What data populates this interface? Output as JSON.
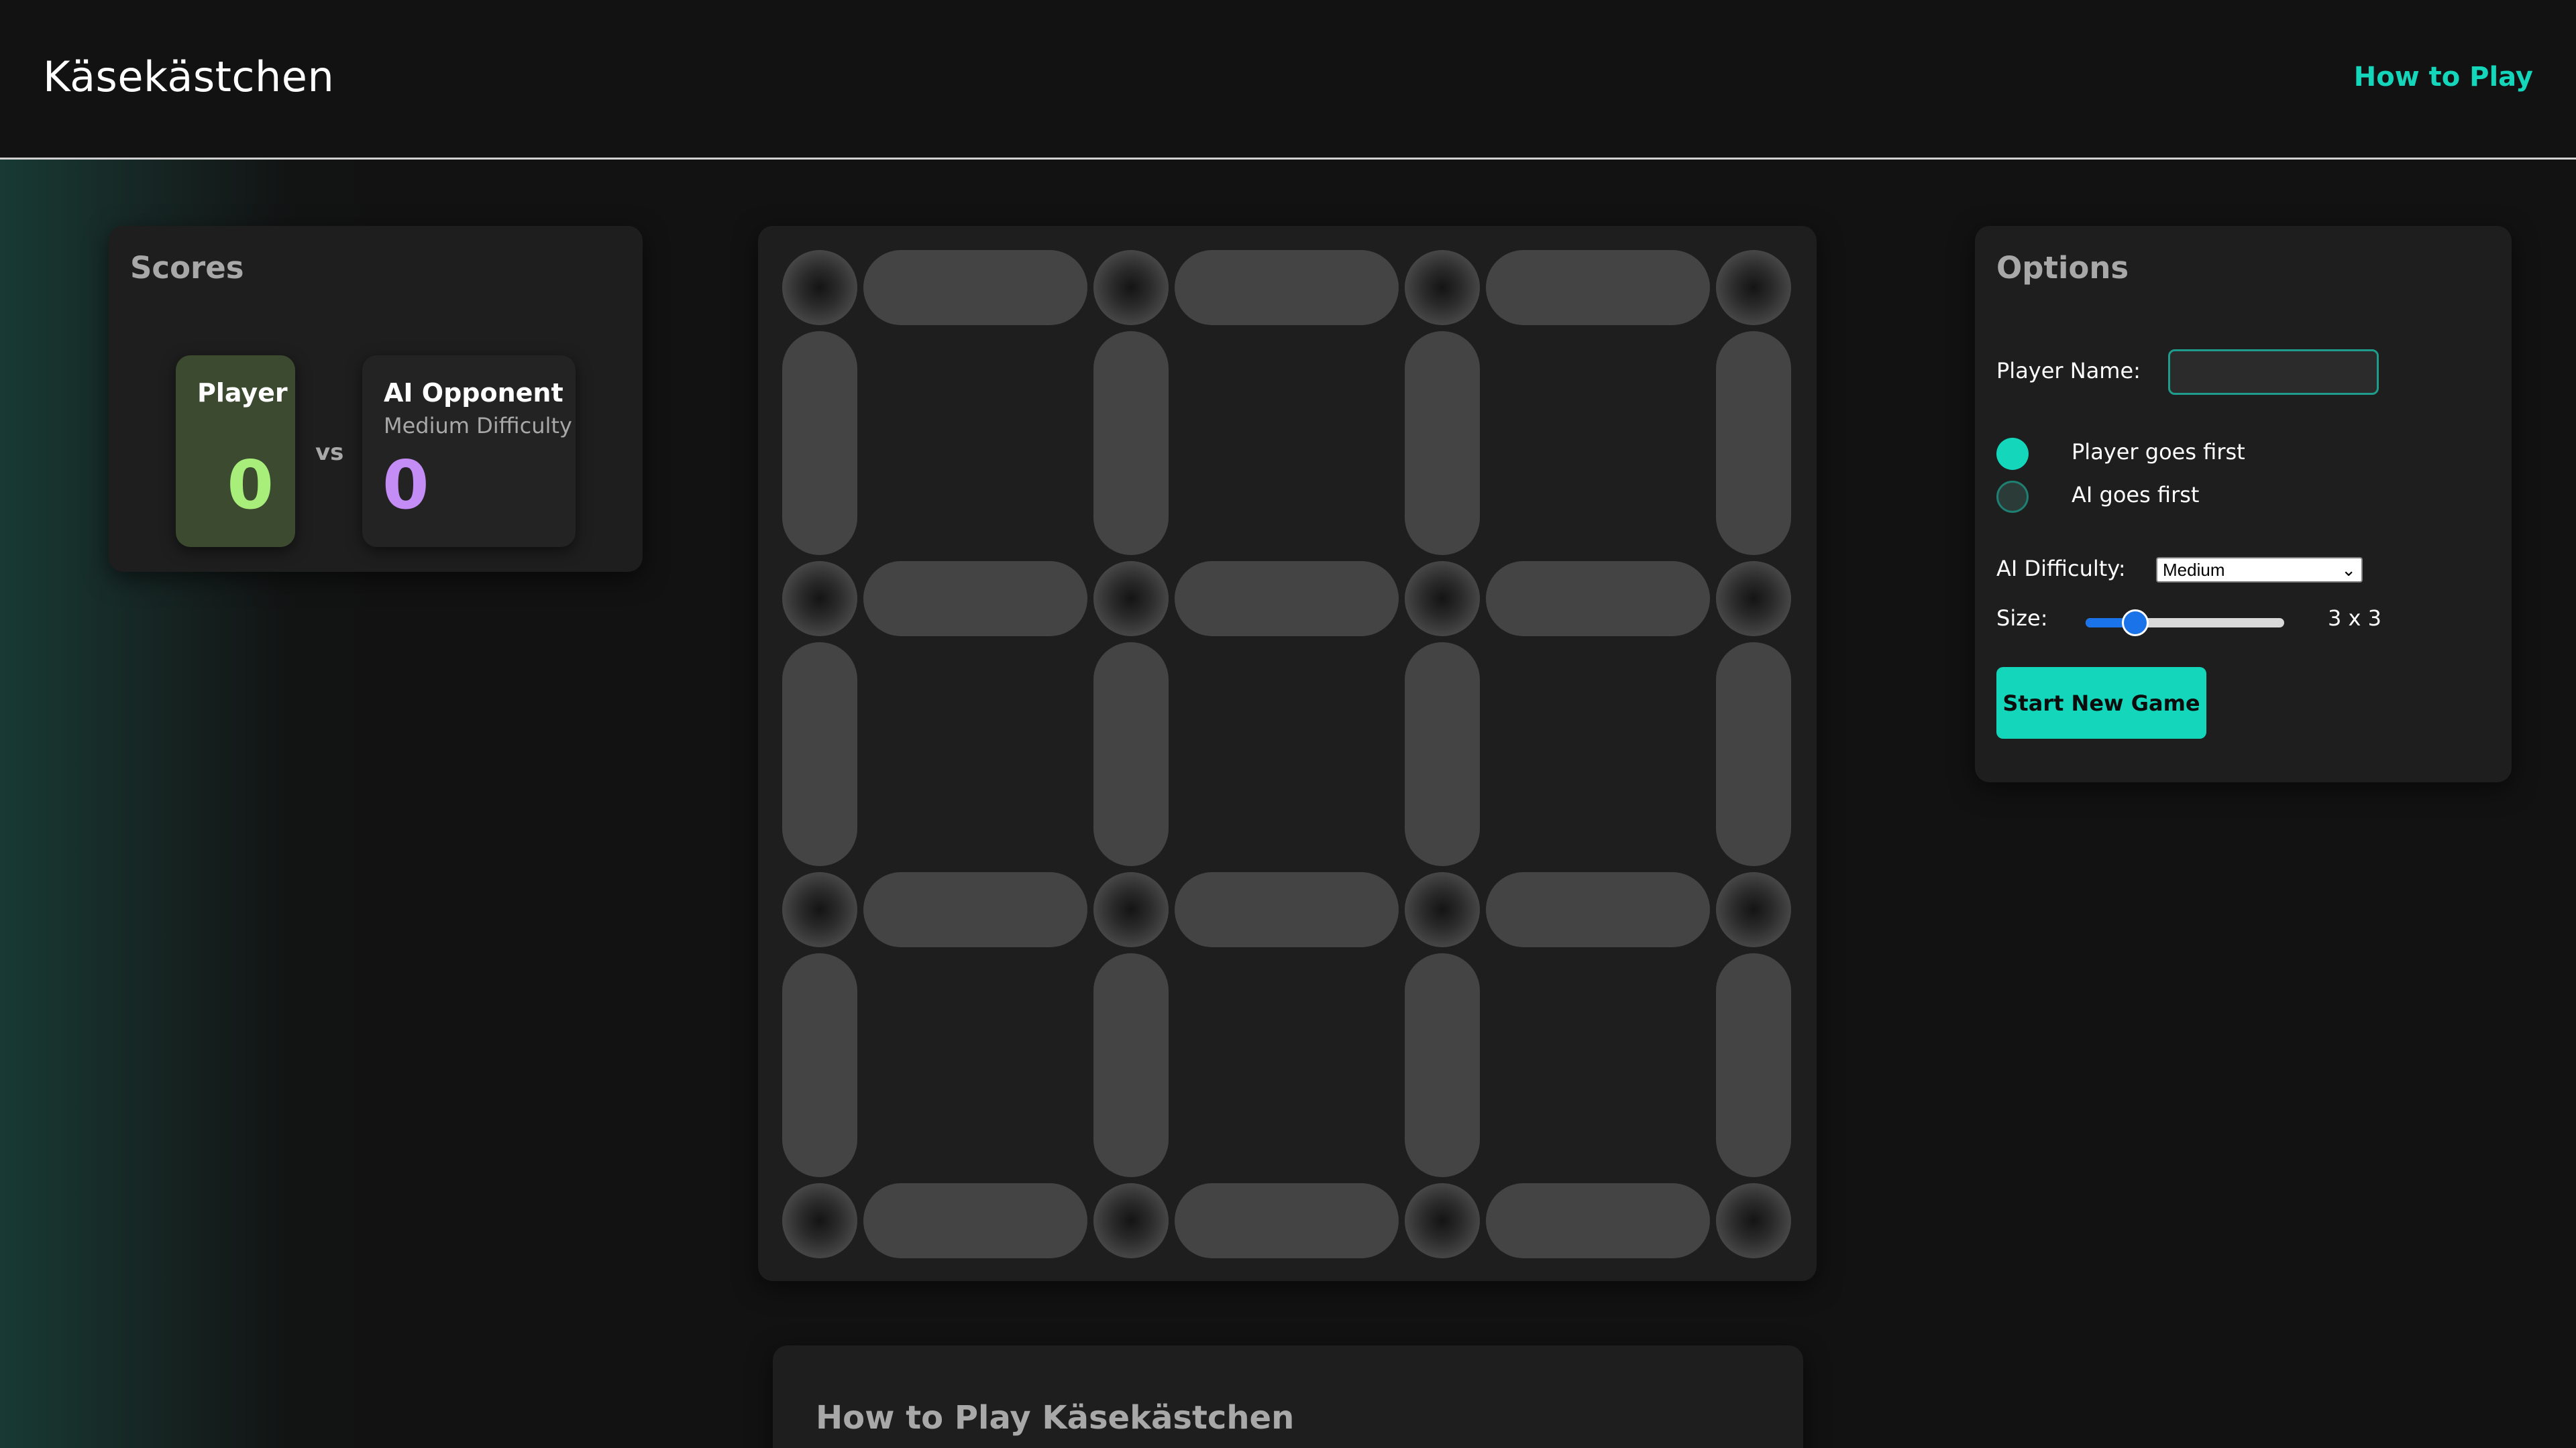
{
  "header": {
    "title": "Käsekästchen",
    "howto_link": "How to Play"
  },
  "scores": {
    "title": "Scores",
    "player": {
      "name": "Player",
      "score": "0"
    },
    "vs": "vs",
    "ai": {
      "name": "AI Opponent",
      "difficulty": "Medium Difficulty",
      "score": "0"
    }
  },
  "board": {
    "rows": 3,
    "cols": 3
  },
  "options": {
    "title": "Options",
    "player_name_label": "Player Name:",
    "player_name_value": "",
    "first_player": {
      "options": [
        "Player goes first",
        "AI goes first"
      ],
      "selected": "Player goes first"
    },
    "difficulty_label": "AI Difficulty:",
    "difficulty_value": "Medium",
    "size_label": "Size:",
    "size_fraction": 0.25,
    "size_value": "3 x 3",
    "start_button": "Start New Game"
  },
  "howto": {
    "title": "How to Play Käsekästchen"
  },
  "colors": {
    "accent": "#13d6bb",
    "player_score": "#a8ee7a",
    "ai_score": "#c48cf5"
  }
}
